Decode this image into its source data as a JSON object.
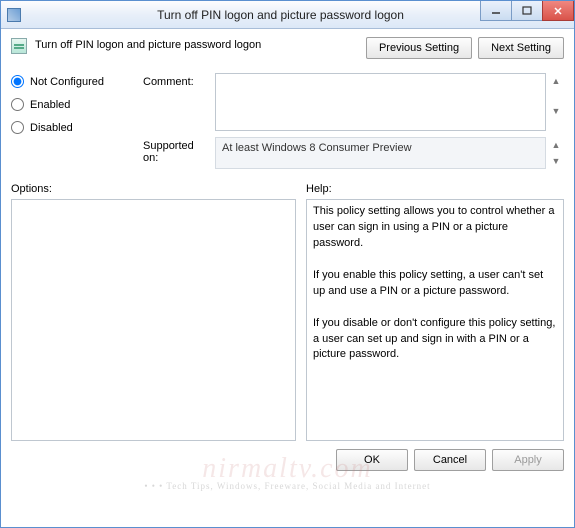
{
  "window": {
    "title": "Turn off PIN logon and picture password logon"
  },
  "header": {
    "policy_title": "Turn off PIN logon and picture password logon",
    "prev_button": "Previous Setting",
    "next_button": "Next Setting"
  },
  "state": {
    "options": [
      {
        "label": "Not Configured",
        "value": "not_configured"
      },
      {
        "label": "Enabled",
        "value": "enabled"
      },
      {
        "label": "Disabled",
        "value": "disabled"
      }
    ],
    "selected": "not_configured"
  },
  "fields": {
    "comment_label": "Comment:",
    "comment_value": "",
    "supported_label": "Supported on:",
    "supported_value": "At least Windows 8 Consumer Preview"
  },
  "sections": {
    "options_label": "Options:",
    "help_label": "Help:",
    "help_text": "This policy setting allows you to control whether a user can sign in using a PIN or a picture password.\n\nIf you enable this policy setting, a user can't set up and use a PIN or a picture password.\n\nIf you disable or don't configure this policy setting, a user can set up and sign in with a PIN or a picture password."
  },
  "footer": {
    "ok": "OK",
    "cancel": "Cancel",
    "apply": "Apply"
  },
  "watermark": {
    "main": "nirmaltv.com",
    "sub": "• • • Tech Tips, Windows, Freeware, Social Media and Internet"
  }
}
